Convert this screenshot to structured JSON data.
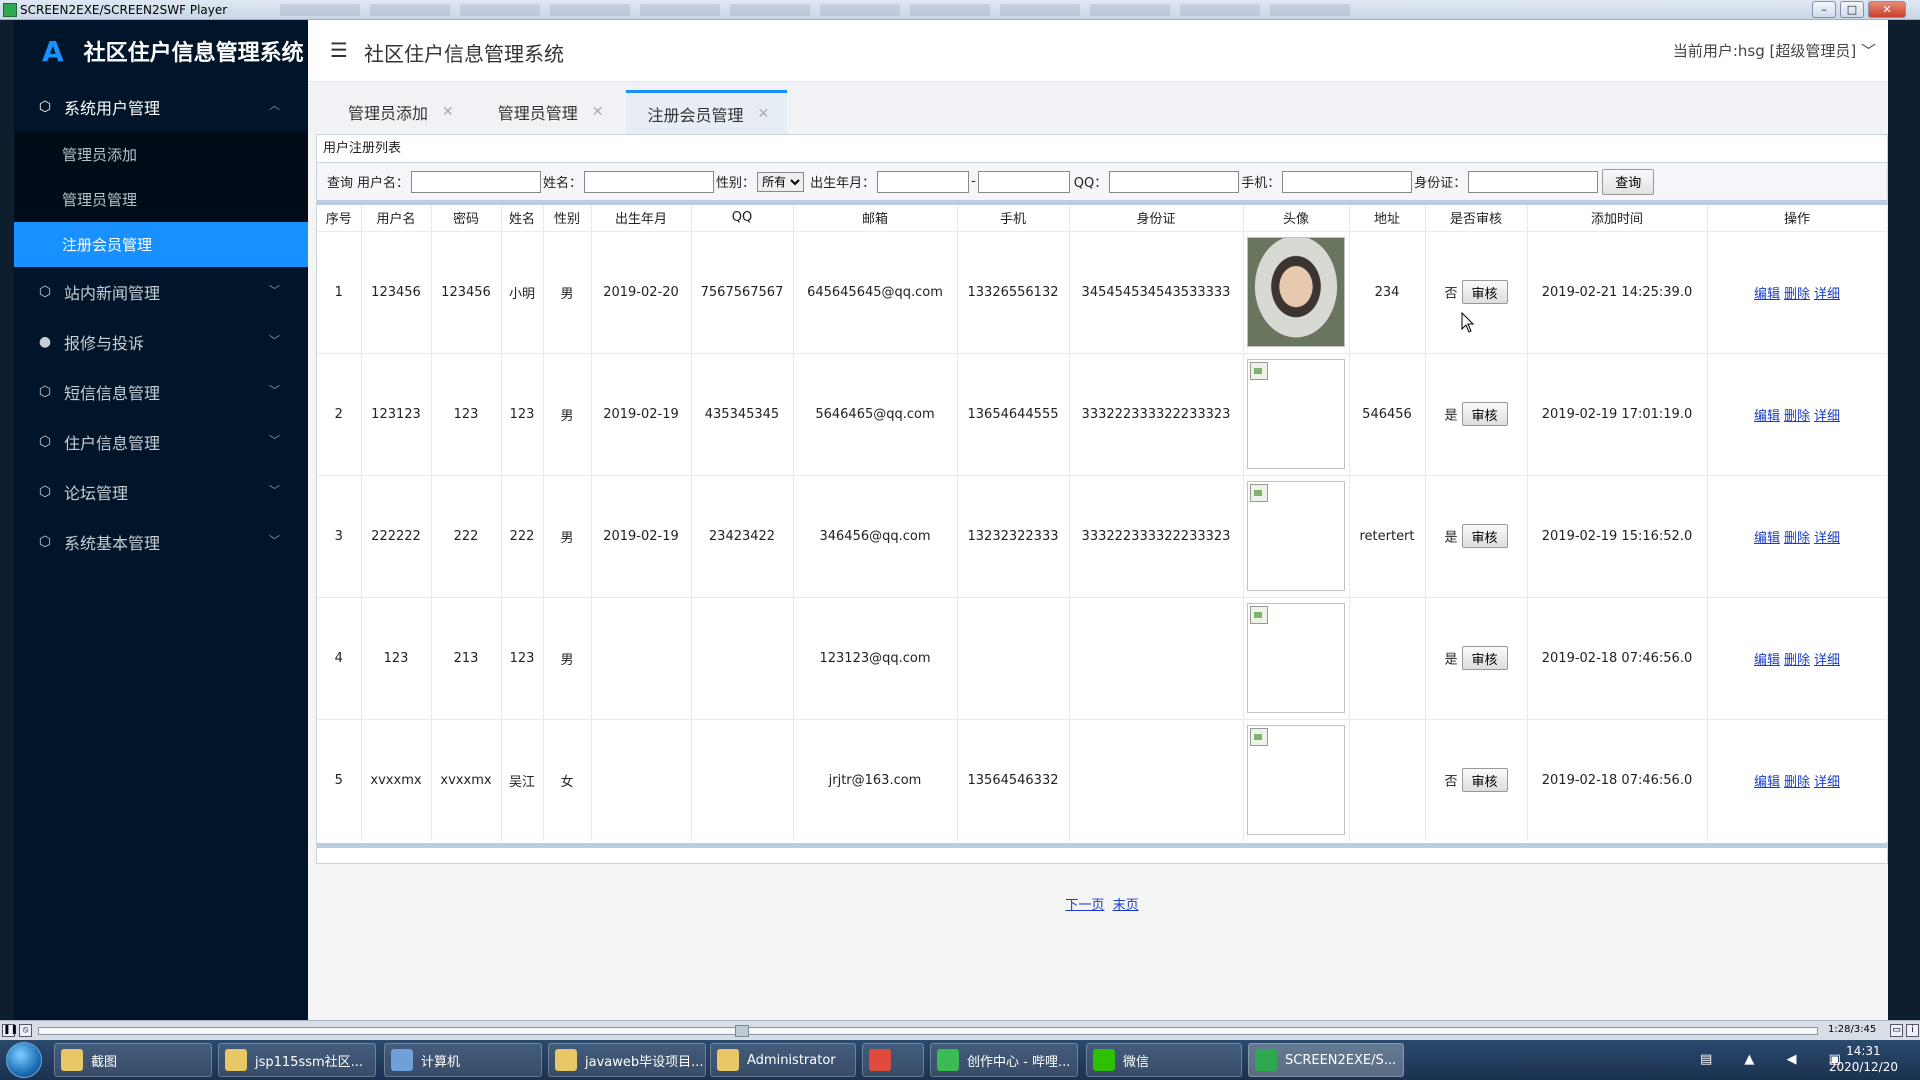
{
  "player": {
    "title": "SCREEN2EXE/SCREEN2SWF Player",
    "time": "1:28/3:45"
  },
  "app": {
    "logo_glyph": "A",
    "logo_title": "社区住户信息管理系统",
    "header_title": "社区住户信息管理系统",
    "current_user": "当前用户:hsg [超级管理员]"
  },
  "sidebar": {
    "groups": [
      {
        "label": "系统用户管理",
        "icon": "box-icon",
        "open": true
      },
      {
        "label": "站内新闻管理",
        "icon": "box-icon"
      },
      {
        "label": "报修与投诉",
        "icon": "user-icon"
      },
      {
        "label": "短信信息管理",
        "icon": "box-icon"
      },
      {
        "label": "住户信息管理",
        "icon": "box-icon"
      },
      {
        "label": "论坛管理",
        "icon": "box-icon"
      },
      {
        "label": "系统基本管理",
        "icon": "box-icon"
      }
    ],
    "sub_items": [
      "管理员添加",
      "管理员管理",
      "注册会员管理"
    ]
  },
  "tabs": [
    {
      "label": "管理员添加"
    },
    {
      "label": "管理员管理"
    },
    {
      "label": "注册会员管理",
      "active": true
    }
  ],
  "panel": {
    "title": "用户注册列表",
    "search": {
      "query_label": "查询",
      "username_label": "用户名：",
      "name_label": "姓名：",
      "gender_label": "性别：",
      "gender_value": "所有",
      "birth_label": "出生年月：",
      "birth_sep": "-",
      "qq_label": "QQ：",
      "phone_label": "手机：",
      "idcard_label": "身份证：",
      "submit": "查询"
    },
    "columns": [
      "序号",
      "用户名",
      "密码",
      "姓名",
      "性别",
      "出生年月",
      "QQ",
      "邮箱",
      "手机",
      "身份证",
      "头像",
      "地址",
      "是否审核",
      "添加时间",
      "操作"
    ],
    "audit_button": "审核",
    "ops": [
      "编辑",
      "删除",
      "详细"
    ],
    "rows": [
      {
        "no": "1",
        "username": "123456",
        "password": "123456",
        "name": "小明",
        "gender": "男",
        "birth": "2019-02-20",
        "qq": "7567567567",
        "email": "645645645@qq.com",
        "phone": "13326556132",
        "idcard": "345454534543533333",
        "avatar": "photo",
        "address": "234",
        "audited": "否",
        "added": "2019-02-21 14:25:39.0"
      },
      {
        "no": "2",
        "username": "123123",
        "password": "123",
        "name": "123",
        "gender": "男",
        "birth": "2019-02-19",
        "qq": "435345345",
        "email": "5646465@qq.com",
        "phone": "13654644555",
        "idcard": "333222333322233323",
        "avatar": "broken",
        "address": "546456",
        "audited": "是",
        "added": "2019-02-19 17:01:19.0"
      },
      {
        "no": "3",
        "username": "222222",
        "password": "222",
        "name": "222",
        "gender": "男",
        "birth": "2019-02-19",
        "qq": "23423422",
        "email": "346456@qq.com",
        "phone": "13232322333",
        "idcard": "333222333322233323",
        "avatar": "broken",
        "address": "retertert",
        "audited": "是",
        "added": "2019-02-19 15:16:52.0"
      },
      {
        "no": "4",
        "username": "123",
        "password": "213",
        "name": "123",
        "gender": "男",
        "birth": "",
        "qq": "",
        "email": "123123@qq.com",
        "phone": "",
        "idcard": "",
        "avatar": "broken",
        "address": "",
        "audited": "是",
        "added": "2019-02-18 07:46:56.0"
      },
      {
        "no": "5",
        "username": "xvxxmx",
        "password": "xvxxmx",
        "name": "吴江",
        "gender": "女",
        "birth": "",
        "qq": "",
        "email": "jrjtr@163.com",
        "phone": "13564546332",
        "idcard": "",
        "avatar": "broken",
        "address": "",
        "audited": "否",
        "added": "2019-02-18 07:46:56.0"
      }
    ],
    "pager": {
      "next": "下一页",
      "last": "末页"
    }
  },
  "taskbar": {
    "items": [
      {
        "label": "截图",
        "color": "#e8c766"
      },
      {
        "label": "jsp115ssm社区...",
        "color": "#e8c766"
      },
      {
        "label": "计算机",
        "color": "#6fa0d8"
      },
      {
        "label": "javaweb毕设项目...",
        "color": "#e8c766"
      },
      {
        "label": "Administrator",
        "color": "#e8c766"
      },
      {
        "label": "",
        "color": "#e04a3c"
      },
      {
        "label": "创作中心 - 哔哩...",
        "color": "#3cba54"
      },
      {
        "label": "微信",
        "color": "#2dc100"
      },
      {
        "label": "SCREEN2EXE/S...",
        "color": "#2fa84f",
        "active": true
      }
    ],
    "clock_time": "14:31",
    "clock_date": "2020/12/20"
  },
  "colors": {
    "accent": "#1890ff",
    "sidebar_bg": "#001529",
    "link": "#1a3cc8"
  }
}
